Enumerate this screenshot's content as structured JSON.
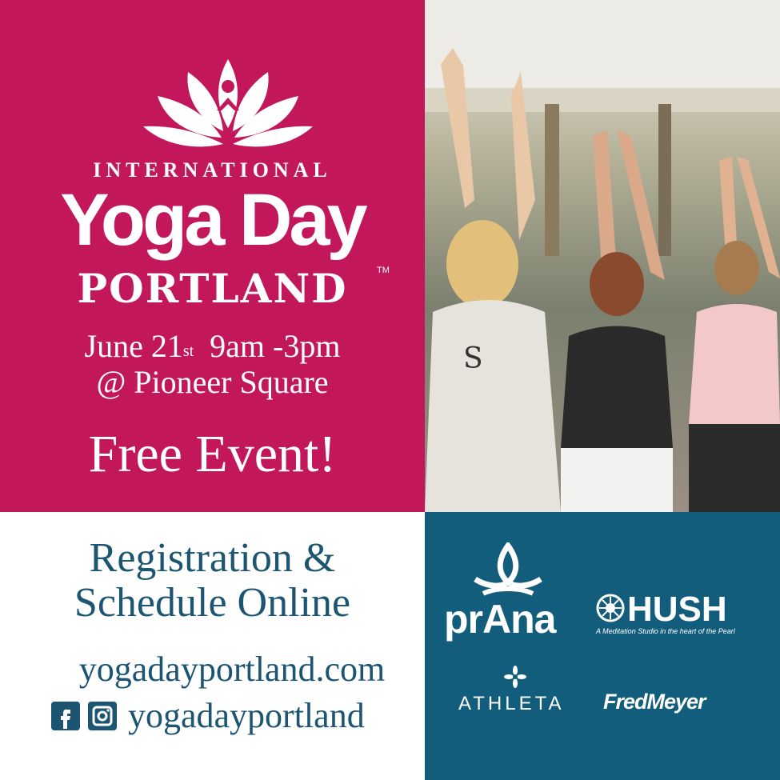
{
  "event": {
    "intl": "INTERNATIONAL",
    "title": "Yoga Day",
    "city": "PORTLAND",
    "tm": "TM",
    "date_day": "June 21",
    "date_suffix": "st",
    "time": "9am -3pm",
    "location": "@ Pioneer Square",
    "free": "Free Event!"
  },
  "info": {
    "registration_line1": "Registration &",
    "registration_line2": "Schedule Online",
    "website": "yogadayportland.com",
    "social_handle": "yogadayportland"
  },
  "icons": [
    "lotus-logo-icon",
    "facebook-icon",
    "instagram-icon",
    "prana-logo-icon",
    "hush-mandala-icon",
    "athleta-flower-icon"
  ],
  "sponsors": {
    "prana": "prAna",
    "hush": "HUSH",
    "hush_tagline": "A Meditation Studio in the heart of the Pearl",
    "athleta": "ATHLETA",
    "fredmeyer": "FredMeyer"
  },
  "colors": {
    "pink": "#c2185b",
    "teal": "#135d7c",
    "text_blue": "#1c5572",
    "white": "#ffffff"
  }
}
